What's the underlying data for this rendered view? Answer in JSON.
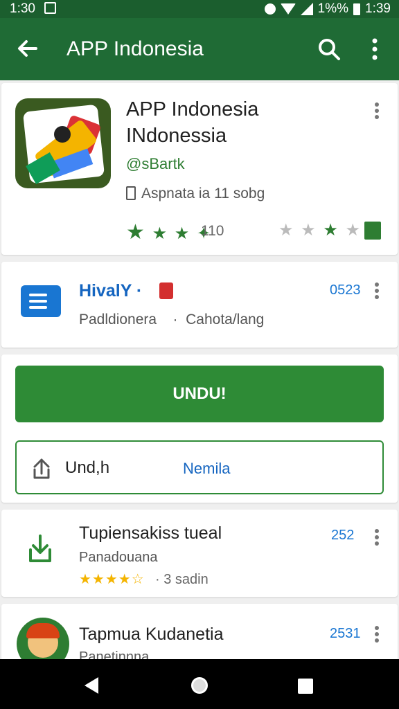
{
  "status_bar": {
    "time_left": "1:30",
    "battery_text": "1%%",
    "time_right": "1:39"
  },
  "app_bar": {
    "title": "APP Indonesia",
    "back_icon": "arrow-back-icon",
    "search_icon": "search-icon",
    "menu_icon": "more-vert-icon"
  },
  "app_card": {
    "title_line1": "APP Indonesia",
    "title_line2": "INdonessia",
    "developer": "@sBartk",
    "info_line": "Aspnata ia 11 sobg",
    "rating_count": "110"
  },
  "hival_card": {
    "title": "HivalY ·",
    "subtitle_left": "Padldionera",
    "subtitle_sep": "·",
    "subtitle_right": "Cahota/lang",
    "number": "0523"
  },
  "actions": {
    "primary_label": "UNDU!",
    "secondary_left": "Und,h",
    "secondary_right": "Nemila"
  },
  "list_items": [
    {
      "title": "Tupiensakiss tueal",
      "subtitle": "Panadouana",
      "meta": "· 3 sadin",
      "number": "252",
      "stars": "★★★★☆"
    },
    {
      "title": "Tapmua Kudanetia",
      "subtitle": "Panetinnna",
      "number": "2531"
    }
  ],
  "colors": {
    "appbar": "#1f6b35",
    "statusbar": "#1b5e2e",
    "primary_button": "#2e8b36",
    "link_blue": "#1565c0"
  }
}
